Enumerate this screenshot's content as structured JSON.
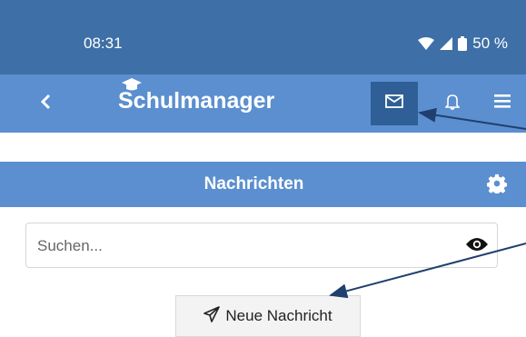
{
  "status_bar": {
    "time": "08:31",
    "battery": "50 %"
  },
  "app_bar": {
    "title": "Schulmanager",
    "icons": [
      "back-chevron-icon",
      "mail-icon",
      "bell-icon",
      "menu-icon"
    ]
  },
  "section": {
    "title": "Nachrichten",
    "settings_icon": "gear-icon"
  },
  "search": {
    "placeholder": "Suchen...",
    "value": ""
  },
  "actions": {
    "new_message_label": "Neue Nachricht"
  },
  "colors": {
    "status_bar_bg": "#3e6fa6",
    "app_bar_bg": "#5b8fcf",
    "active_button_bg": "#2f5f96",
    "annotation_arrow": "#1f3f6f"
  }
}
